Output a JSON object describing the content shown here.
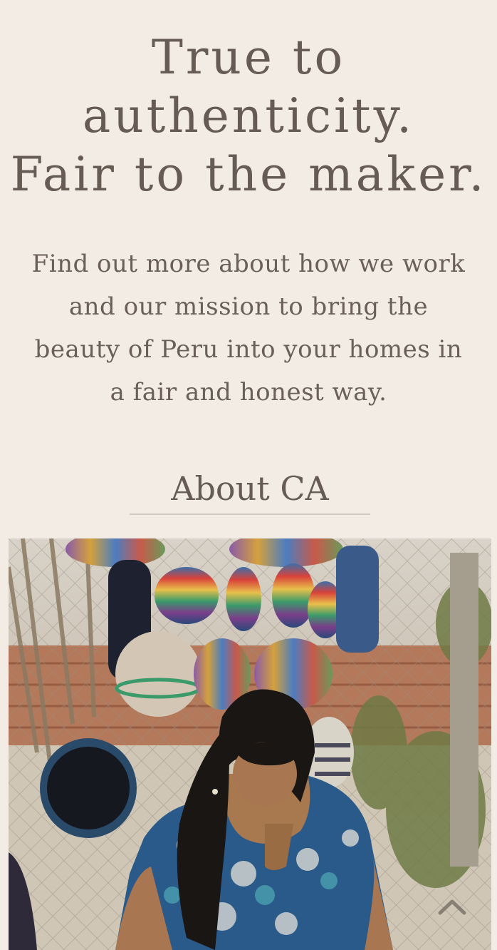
{
  "hero": {
    "line1": "True to authenticity.",
    "line2": "Fair to the maker."
  },
  "intro": {
    "text": "Find out more about how we work and our mission to bring the beauty of Peru into your homes in a fair and honest way."
  },
  "about_link": {
    "label": "About CA"
  },
  "photo": {
    "subject": "artisan woman with woven hats and bags"
  },
  "icons": {
    "scroll_top": "chevron-up-icon"
  },
  "colors": {
    "background": "#f3ece4",
    "text": "#665c53",
    "divider": "#cfc8c0"
  }
}
